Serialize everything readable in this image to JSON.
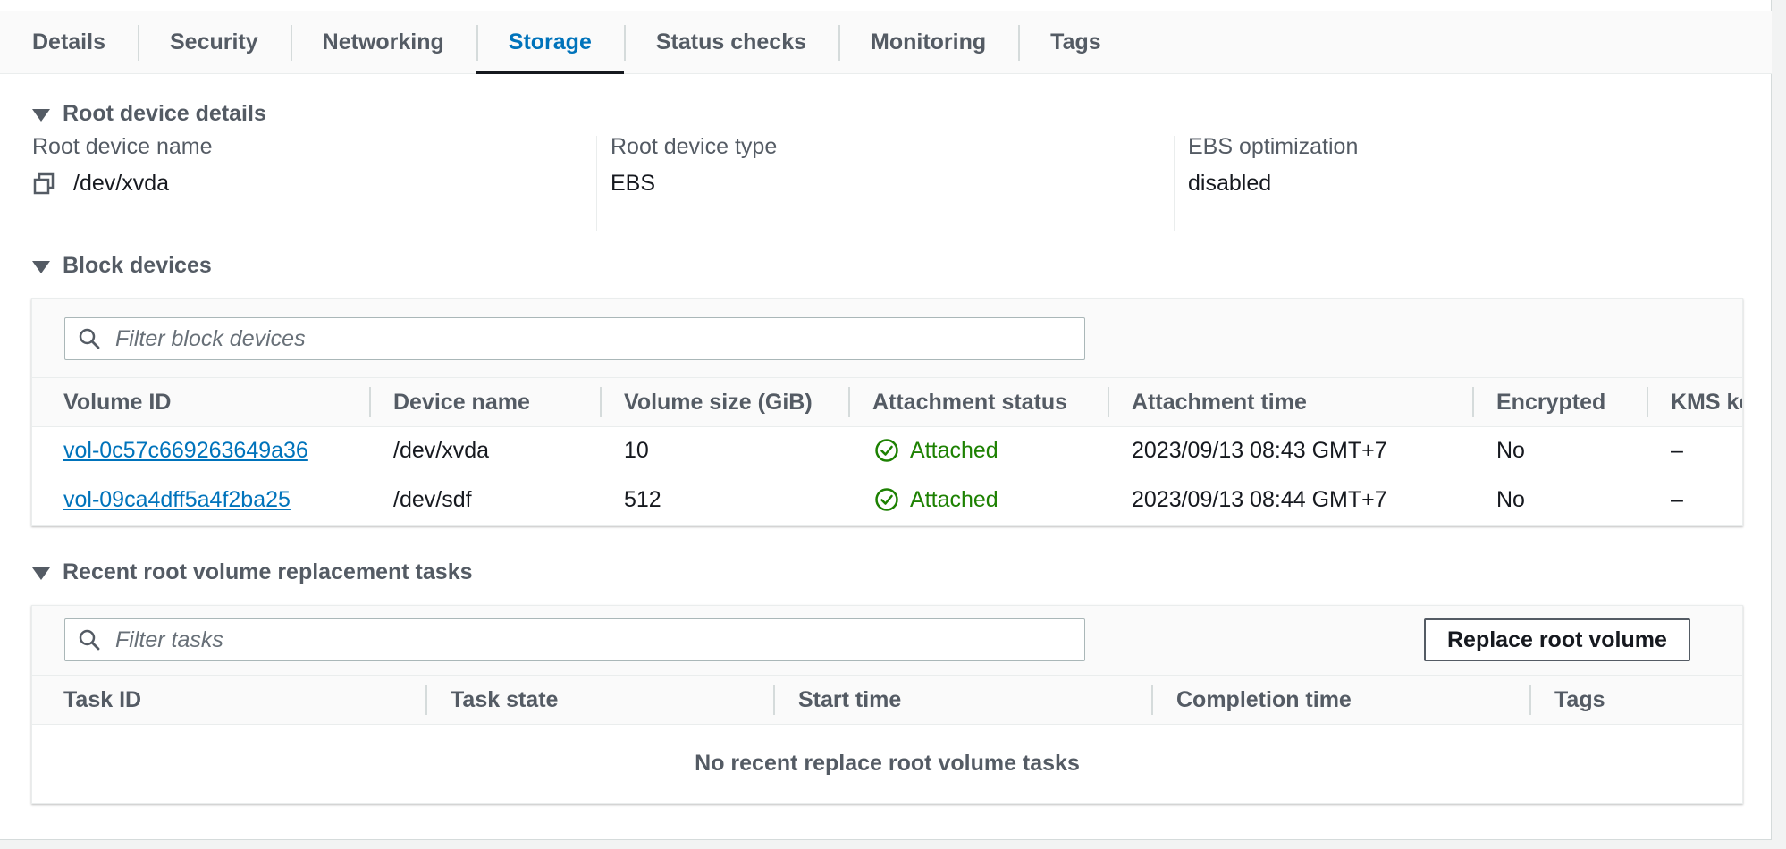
{
  "tabs": [
    {
      "label": "Details"
    },
    {
      "label": "Security"
    },
    {
      "label": "Networking"
    },
    {
      "label": "Storage",
      "active": true
    },
    {
      "label": "Status checks"
    },
    {
      "label": "Monitoring"
    },
    {
      "label": "Tags"
    }
  ],
  "root_device": {
    "section_title": "Root device details",
    "fields": [
      {
        "label": "Root device name",
        "value": "/dev/xvda"
      },
      {
        "label": "Root device type",
        "value": "EBS"
      },
      {
        "label": "EBS optimization",
        "value": "disabled"
      }
    ]
  },
  "block_devices": {
    "section_title": "Block devices",
    "filter_placeholder": "Filter block devices",
    "columns": [
      "Volume ID",
      "Device name",
      "Volume size (GiB)",
      "Attachment status",
      "Attachment time",
      "Encrypted",
      "KMS ke"
    ],
    "rows": [
      {
        "volume_id": "vol-0c57c669263649a36",
        "device_name": "/dev/xvda",
        "size": "10",
        "status": "Attached",
        "time": "2023/09/13 08:43 GMT+7",
        "encrypted": "No",
        "kms": "–"
      },
      {
        "volume_id": "vol-09ca4dff5a4f2ba25",
        "device_name": "/dev/sdf",
        "size": "512",
        "status": "Attached",
        "time": "2023/09/13 08:44 GMT+7",
        "encrypted": "No",
        "kms": "–"
      }
    ]
  },
  "replacement_tasks": {
    "section_title": "Recent root volume replacement tasks",
    "filter_placeholder": "Filter tasks",
    "button_label": "Replace root volume",
    "columns": [
      "Task ID",
      "Task state",
      "Start time",
      "Completion time",
      "Tags"
    ],
    "empty_message": "No recent replace root volume tasks"
  },
  "colors": {
    "accent": "#0073bb",
    "success": "#1d8102",
    "text": "#16191f",
    "muted": "#545b64"
  }
}
